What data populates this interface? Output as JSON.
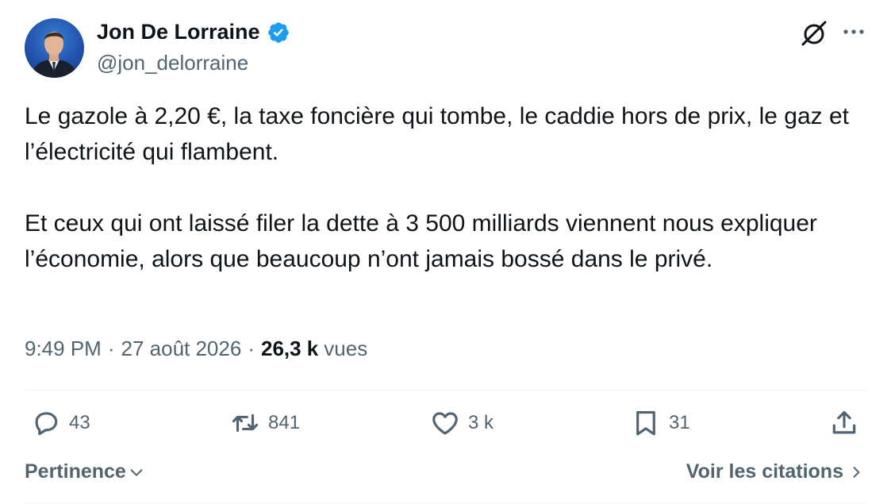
{
  "author": {
    "name": "Jon De Lorraine",
    "handle": "@jon_delorraine",
    "verified": true,
    "badge_color": "#1d9bf0"
  },
  "tweet": {
    "paragraphs": [
      "Le gazole à 2,20 €, la taxe foncière qui tombe, le caddie hors de prix, le gaz et l’électricité qui flambent.",
      "Et ceux qui ont laissé filer la dette à 3 500 milliards viennent nous expliquer l’économie, alors que beaucoup n’ont jamais bossé dans le privé."
    ]
  },
  "meta": {
    "time": "9:49 PM",
    "separator": "·",
    "date": "27 août 2026",
    "views_count": "26,3 k",
    "views_label": "vues"
  },
  "actions": {
    "replies": "43",
    "reposts": "841",
    "likes": "3 k",
    "bookmarks": "31"
  },
  "footer": {
    "sort_label": "Pertinence",
    "quotes_label": "Voir les citations"
  },
  "colors": {
    "text": "#0f1419",
    "secondary": "#536471",
    "divider": "#eff3f4"
  }
}
